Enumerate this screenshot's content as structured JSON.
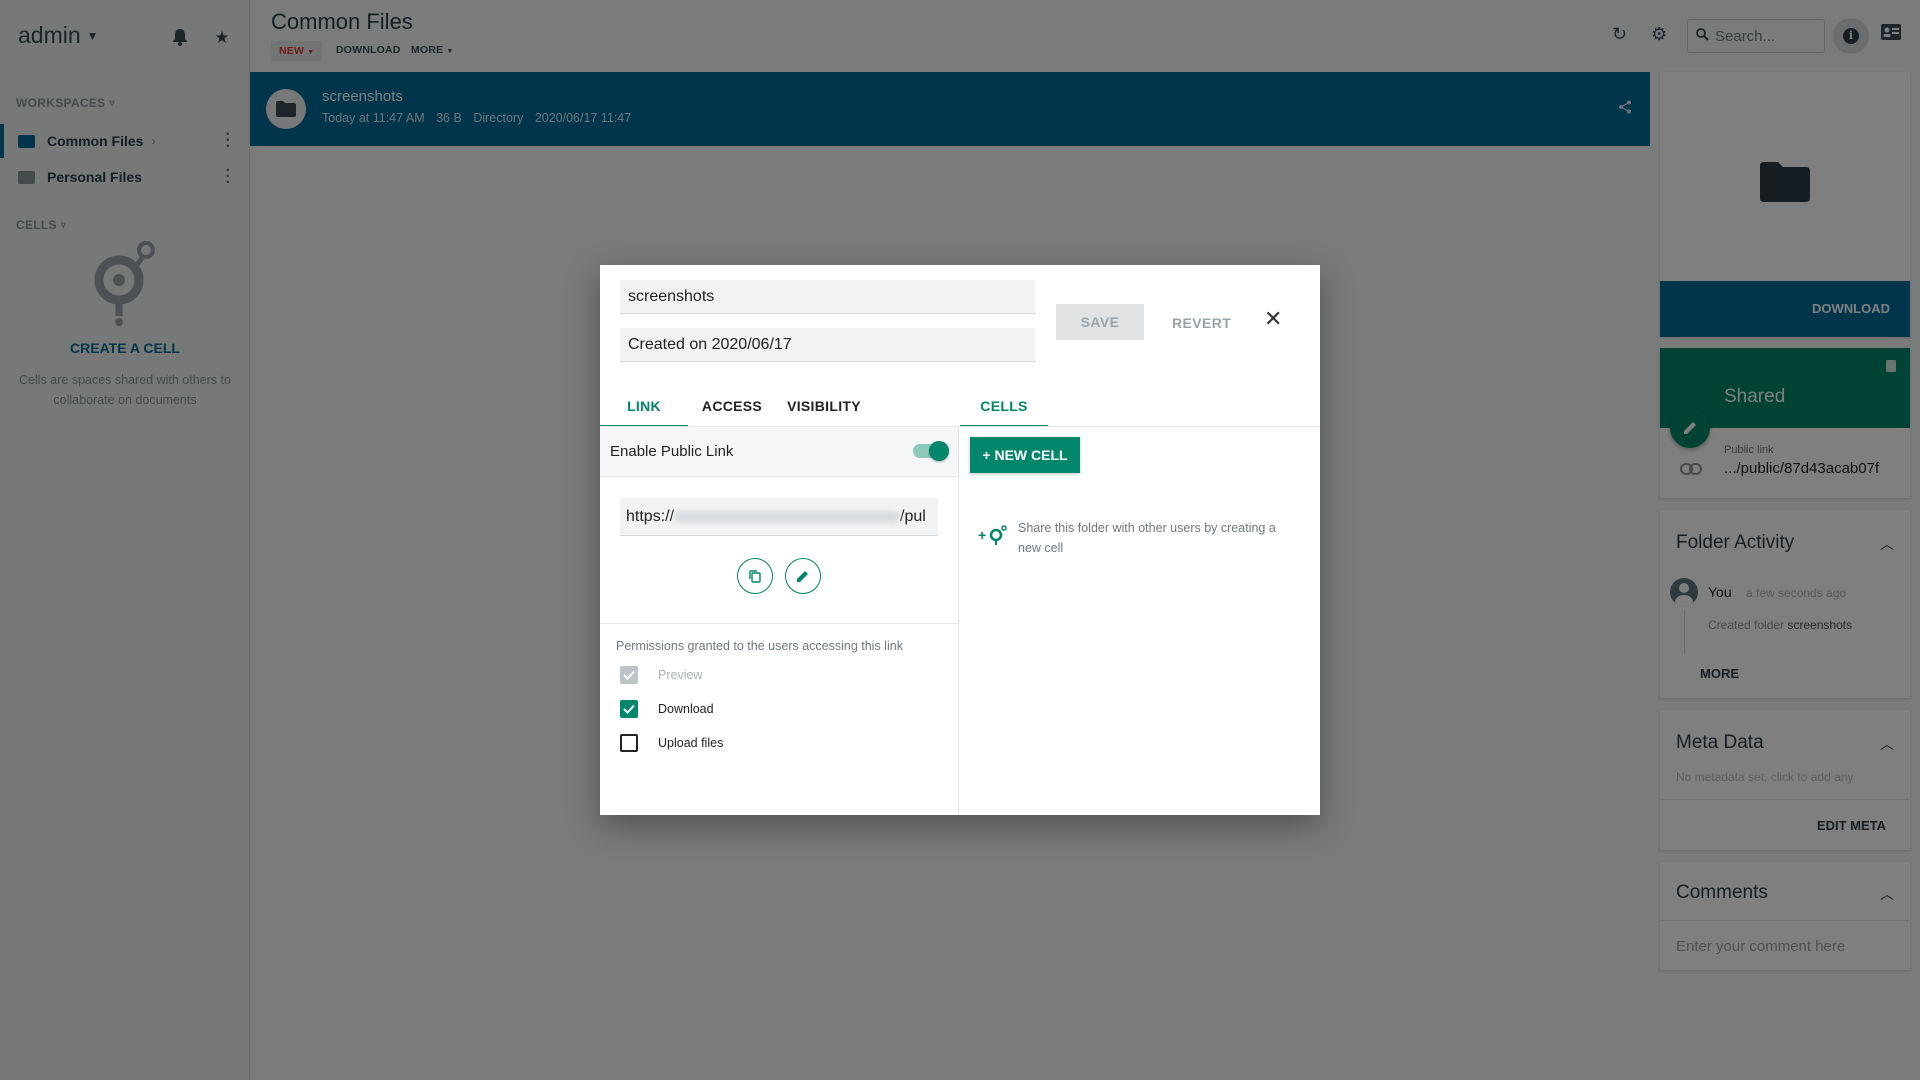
{
  "sidebar": {
    "user": "admin",
    "workspaces_title": "WORKSPACES",
    "workspaces": [
      {
        "label": "Common Files",
        "color": "#006a96"
      },
      {
        "label": "Personal Files",
        "color": "#6f7a80"
      }
    ],
    "cells_title": "CELLS",
    "create_cell": "CREATE A CELL",
    "cells_desc": "Cells are spaces shared with others to collaborate on documents"
  },
  "header": {
    "title": "Common Files",
    "new_label": "NEW",
    "download_label": "DOWNLOAD",
    "more_label": "MORE",
    "search_placeholder": "Search..."
  },
  "selected": {
    "name": "screenshots",
    "modified": "Today at 11:47 AM",
    "size": "36 B",
    "type": "Directory",
    "date": "2020/06/17 11:47"
  },
  "right_panel": {
    "download_label": "DOWNLOAD",
    "shared_title": "Shared",
    "public_link_label": "Public link",
    "public_link_value": ".../public/87d43acab07f",
    "activity_title": "Folder Activity",
    "activity_user": "You",
    "activity_time": "a few seconds ago",
    "activity_text_prefix": "Created folder ",
    "activity_text_target": "screenshots",
    "activity_more": "MORE",
    "meta_title": "Meta Data",
    "meta_empty": "No metadata set, click to add any",
    "edit_meta": "EDIT META",
    "comments_title": "Comments",
    "comment_placeholder": "Enter your comment here"
  },
  "modal": {
    "name_value": "screenshots",
    "created_value": "Created on 2020/06/17",
    "save_label": "SAVE",
    "revert_label": "REVERT",
    "tabs_left": [
      "LINK",
      "ACCESS",
      "VISIBILITY"
    ],
    "tab_right": "CELLS",
    "enable_public_link": "Enable Public Link",
    "url_prefix": "https://",
    "url_suffix": "/pul",
    "permissions_title": "Permissions granted to the users accessing this link",
    "permissions": [
      {
        "label": "Preview",
        "state": "checked-disabled"
      },
      {
        "label": "Download",
        "state": "checked"
      },
      {
        "label": "Upload files",
        "state": "unchecked"
      }
    ],
    "new_cell_label": "+ NEW CELL",
    "share_hint": "Share this folder with other users by creating a new cell"
  },
  "colors": {
    "primary": "#006a96",
    "accent": "#00866a",
    "danger": "#e53935"
  }
}
